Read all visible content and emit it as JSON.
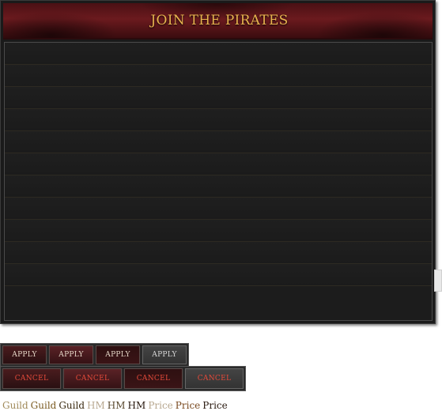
{
  "panel": {
    "title": "JOIN THE PIRATES",
    "rows": [
      "",
      "",
      "",
      "",
      "",
      "",
      "",
      "",
      "",
      "",
      ""
    ]
  },
  "apply_buttons": [
    {
      "label": "APPLY",
      "state": "normal"
    },
    {
      "label": "APPLY",
      "state": "hover"
    },
    {
      "label": "APPLY",
      "state": "pressed"
    },
    {
      "label": "APPLY",
      "state": "disabled"
    }
  ],
  "cancel_buttons": [
    {
      "label": "CANCEL",
      "state": "normal"
    },
    {
      "label": "CANCEL",
      "state": "hover"
    },
    {
      "label": "CANCEL",
      "state": "pressed"
    },
    {
      "label": "CANCEL",
      "state": "disabled"
    }
  ],
  "text_samples": {
    "guild": [
      "Guild",
      "Guild",
      "Guild"
    ],
    "hm": [
      "HM",
      "HM",
      "HM"
    ],
    "price": [
      "Price",
      "Price",
      "Price"
    ]
  },
  "colors": {
    "title": "#e9b44f",
    "header": "#6b1a1e",
    "panel_bg": "#1a1a1a",
    "cancel_text": "#e44a3a"
  }
}
